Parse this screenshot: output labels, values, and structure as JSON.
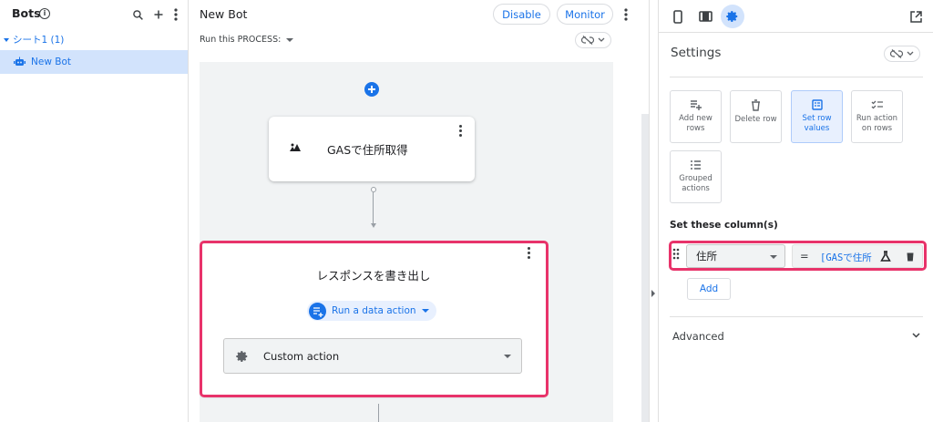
{
  "sidebar": {
    "title": "Bots",
    "info_glyph": "i",
    "group_label": "シート1 (1)",
    "bot_item": "New Bot"
  },
  "editor": {
    "bot_name": "New Bot",
    "disable_label": "Disable",
    "monitor_label": "Monitor",
    "run_process_label": "Run this PROCESS:",
    "step1_title": "GASで住所取得",
    "step2_title": "レスポンスを書き出し",
    "data_action_label": "Run a data action",
    "custom_action_label": "Custom action"
  },
  "panel": {
    "settings_title": "Settings",
    "tiles": [
      {
        "label": "Add new rows",
        "icon": "add-rows-icon",
        "selected": false
      },
      {
        "label": "Delete row",
        "icon": "trash-icon",
        "selected": false
      },
      {
        "label": "Set row values",
        "icon": "edit-row-icon",
        "selected": true
      },
      {
        "label": "Run action on rows",
        "icon": "checklist-icon",
        "selected": false
      },
      {
        "label": "Grouped actions",
        "icon": "list-icon",
        "selected": false
      }
    ],
    "set_columns_label": "Set these column(s)",
    "column_name": "住所",
    "equals": "=",
    "expression": "[GASで住所",
    "add_label": "Add",
    "advanced_label": "Advanced"
  },
  "colors": {
    "accent": "#1a73e8",
    "highlight": "#e8336a",
    "canvas_bg": "#f1f3f4",
    "selected_bg": "#d2e3fc"
  }
}
